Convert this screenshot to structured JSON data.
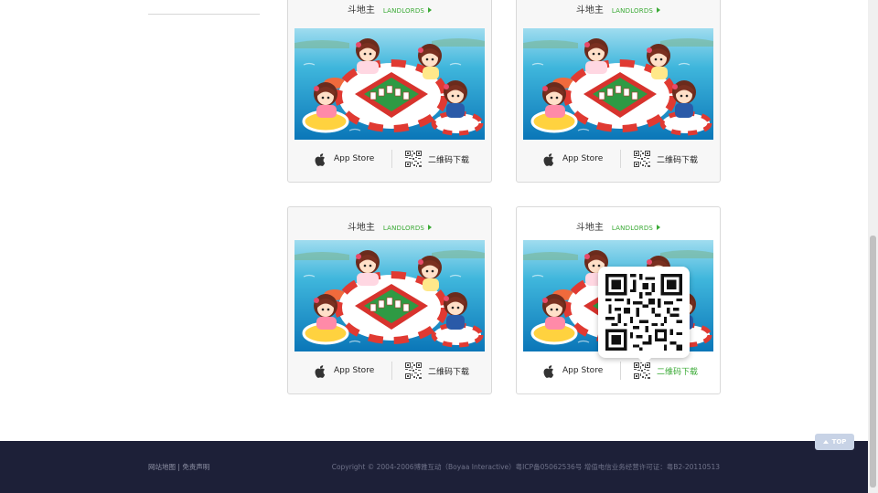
{
  "games": [
    {
      "title": "斗地主",
      "title_en": "LANDLORDS",
      "appstore_label": "App Store",
      "qr_label": "二维码下载"
    },
    {
      "title": "斗地主",
      "title_en": "LANDLORDS",
      "appstore_label": "App Store",
      "qr_label": "二维码下载"
    },
    {
      "title": "斗地主",
      "title_en": "LANDLORDS",
      "appstore_label": "App Store",
      "qr_label": "二维码下载"
    },
    {
      "title": "斗地主",
      "title_en": "LANDLORDS",
      "appstore_label": "App Store",
      "qr_label": "二维码下载"
    }
  ],
  "footer": {
    "sitemap": "网站地图",
    "divider": "|",
    "disclaimer": "免责声明",
    "copyright": "Copyright © 2004-2006博雅互动（Boyaa Interactive）粤ICP备05062536号 增值电信业务经营许可证：粤B2-20110513"
  },
  "top_button": {
    "label": "TOP"
  },
  "colors": {
    "accent": "#3aaa35",
    "footer_bg": "#1d2038",
    "card_bg": "#f7f7f7"
  }
}
